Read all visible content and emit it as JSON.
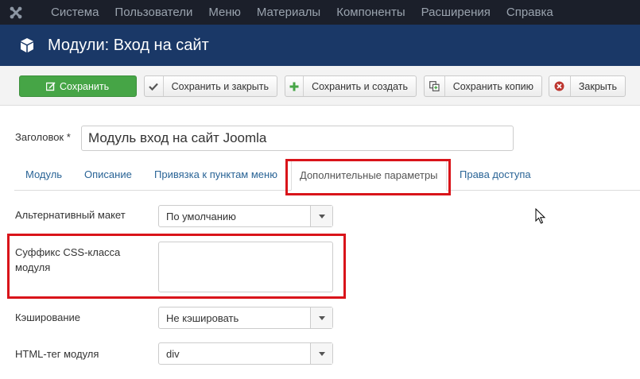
{
  "nav": {
    "items": [
      "Система",
      "Пользователи",
      "Меню",
      "Материалы",
      "Компоненты",
      "Расширения",
      "Справка"
    ]
  },
  "header": {
    "title": "Модули: Вход на сайт"
  },
  "toolbar": {
    "save_label": "Сохранить",
    "save_close_label": "Сохранить и закрыть",
    "save_new_label": "Сохранить и создать",
    "save_copy_label": "Сохранить копию",
    "close_label": "Закрыть"
  },
  "form": {
    "title_label": "Заголовок *",
    "title_value": "Модуль вход на сайт Joomla"
  },
  "tabs": [
    "Модуль",
    "Описание",
    "Привязка к пунктам меню",
    "Дополнительные параметры",
    "Права доступа"
  ],
  "active_tab": "Дополнительные параметры",
  "params": {
    "layout_label": "Альтернативный макет",
    "layout_value": "По умолчанию",
    "suffix_label_line1": "Суффикс CSS-класса",
    "suffix_label_line2": "модуля",
    "suffix_value": "",
    "cache_label": "Кэширование",
    "cache_value": "Не кэшировать",
    "tag_label": "HTML-тег модуля",
    "tag_value": "div"
  },
  "colors": {
    "nav_bg": "#1b1f2a",
    "header_bg": "#1a3867",
    "save_green": "#46a546",
    "highlight_red": "#d9141a",
    "link_blue": "#2a6496"
  }
}
